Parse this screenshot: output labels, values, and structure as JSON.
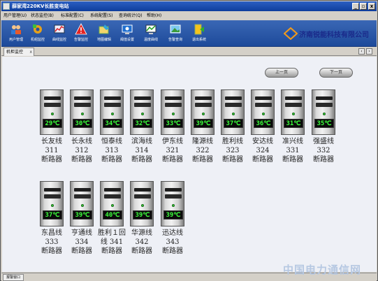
{
  "window": {
    "title": "薛家湾220KV长胜变电站",
    "min_label": "_",
    "max_label": "▫",
    "close_label": "x"
  },
  "menu": [
    "用户管理(U)",
    "状态监控(B)",
    "标准配置(C)",
    "系统配置(S)",
    "查询统计(Q)",
    "帮助(H)"
  ],
  "toolbar": [
    "用户管理",
    "机组监控",
    "曲线监控",
    "告警监控",
    "地图编辑",
    "阈值设置",
    "温度曲线",
    "告警查询",
    "退出系统"
  ],
  "company": "济南锐能科技有限公司",
  "tab": {
    "label": "机柜监控",
    "close": "x"
  },
  "nav": {
    "prev": "上一页",
    "next": "下一页"
  },
  "breakers": [
    {
      "name": "长友线",
      "number": "311",
      "suffix": "断路器",
      "temp": "29℃"
    },
    {
      "name": "长永线",
      "number": "312",
      "suffix": "断路器",
      "temp": "30℃"
    },
    {
      "name": "恒泰线",
      "number": "313",
      "suffix": "断路器",
      "temp": "34℃"
    },
    {
      "name": "滨海线",
      "number": "314",
      "suffix": "断路器",
      "temp": "32℃"
    },
    {
      "name": "伊东线",
      "number": "321",
      "suffix": "断路器",
      "temp": "33℃"
    },
    {
      "name": "隆源线",
      "number": "322",
      "suffix": "断路器",
      "temp": "39℃"
    },
    {
      "name": "胜利线",
      "number": "323",
      "suffix": "断路器",
      "temp": "37℃"
    },
    {
      "name": "安达线",
      "number": "324",
      "suffix": "断路器",
      "temp": "36℃"
    },
    {
      "name": "准兴线",
      "number": "331",
      "suffix": "断路器",
      "temp": "31℃"
    },
    {
      "name": "强盛线",
      "number": "332",
      "suffix": "断路器",
      "temp": "35℃"
    },
    {
      "name": "东昌线",
      "number": "333",
      "suffix": "断路器",
      "temp": "37℃"
    },
    {
      "name": "亨通线",
      "number": "334",
      "suffix": "断路器",
      "temp": "39℃"
    },
    {
      "name": "胜利１回",
      "number": "线 341",
      "suffix": "断路器",
      "temp": "40℃"
    },
    {
      "name": "华源线",
      "number": "342",
      "suffix": "断路器",
      "temp": "39℃"
    },
    {
      "name": "迅达线",
      "number": "343",
      "suffix": "断路器",
      "temp": "39℃"
    }
  ],
  "status": {
    "tab_label": "报警窗口"
  },
  "watermark": "中国电力通信网"
}
